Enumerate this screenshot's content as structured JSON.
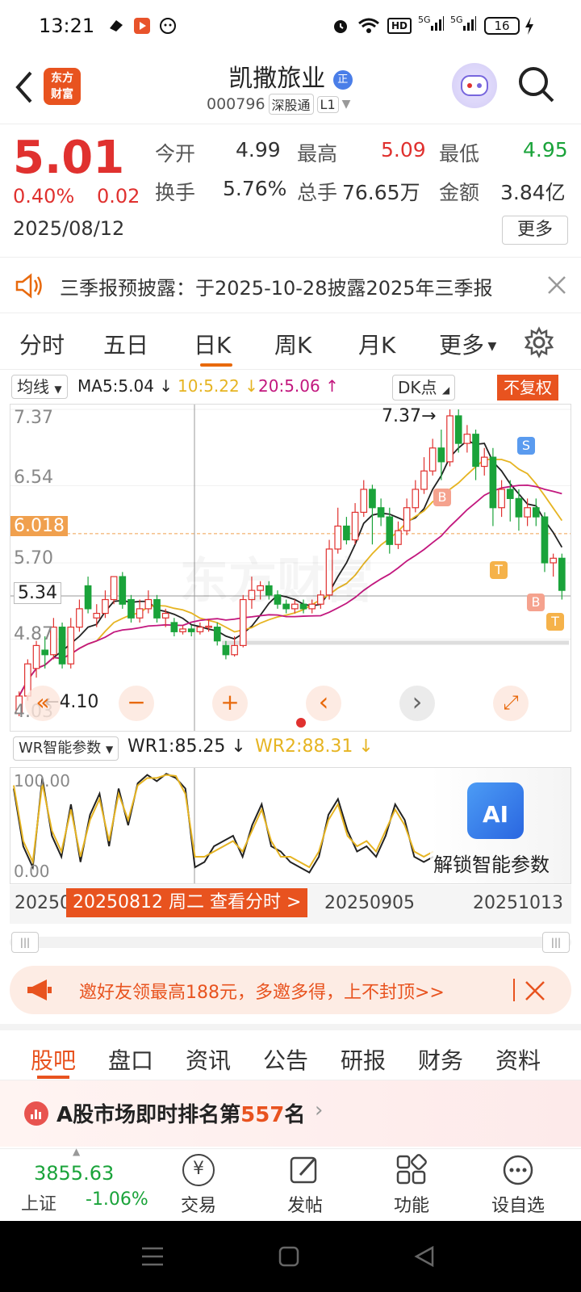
{
  "status": {
    "time": "13:21",
    "battery": "16",
    "hd": "HD",
    "net1": "5G",
    "net2": "5G"
  },
  "header": {
    "logo_line1": "东方",
    "logo_line2": "财富",
    "title": "凯撒旅业",
    "badge": "正",
    "code": "000796",
    "market": "深股通",
    "level": "L1"
  },
  "quote": {
    "price": "5.01",
    "change_pct": "0.40%",
    "change": "0.02",
    "date": "2025/08/12",
    "open_label": "今开",
    "open": "4.99",
    "high_label": "最高",
    "high": "5.09",
    "low_label": "最低",
    "low": "4.95",
    "turnover_label": "换手",
    "turnover": "5.76%",
    "volume_label": "总手",
    "volume": "76.65万",
    "amount_label": "金额",
    "amount": "3.84亿",
    "more": "更多"
  },
  "notice": {
    "text": "三季报预披露：于2025-10-28披露2025年三季报"
  },
  "tabs": [
    "分时",
    "五日",
    "日K",
    "周K",
    "月K",
    "更多"
  ],
  "active_tab": 2,
  "indicators": {
    "selector": "均线",
    "ma5": "MA5:5.04",
    "ma10": "10:5.22",
    "ma20": "20:5.06",
    "dk": "DK点",
    "adjust": "不复权"
  },
  "kchart": {
    "y_labels": [
      "7.37",
      "6.54",
      "5.70",
      "4.87",
      "4.03"
    ],
    "cursor_price": "5.34",
    "ref_price": "6.018",
    "peak_label": "7.37",
    "low_label": "4.10",
    "marks": {
      "b": "B",
      "s": "S",
      "t": "T"
    },
    "watermark": "东方财富"
  },
  "chart_data": {
    "type": "candlestick",
    "note_series": [
      "MA5",
      "MA10",
      "MA20"
    ],
    "ylim": [
      4.03,
      7.37
    ],
    "candles": [
      [
        4.06,
        4.25,
        4.03,
        4.3
      ],
      [
        4.25,
        4.6,
        4.2,
        4.65
      ],
      [
        4.55,
        4.8,
        4.45,
        4.85
      ],
      [
        4.75,
        4.7,
        4.55,
        4.9
      ],
      [
        4.7,
        5.0,
        4.65,
        5.1
      ],
      [
        5.0,
        4.6,
        4.55,
        5.05
      ],
      [
        4.6,
        5.0,
        4.55,
        5.1
      ],
      [
        5.0,
        5.2,
        4.95,
        5.3
      ],
      [
        5.45,
        5.2,
        5.15,
        5.55
      ],
      [
        5.1,
        5.15,
        5.0,
        5.25
      ],
      [
        5.15,
        5.3,
        5.1,
        5.4
      ],
      [
        5.3,
        5.55,
        5.25,
        5.55
      ],
      [
        5.55,
        5.25,
        5.2,
        5.6
      ],
      [
        5.3,
        5.1,
        5.05,
        5.35
      ],
      [
        5.1,
        5.2,
        5.05,
        5.3
      ],
      [
        5.2,
        5.3,
        5.15,
        5.4
      ],
      [
        5.3,
        5.1,
        5.05,
        5.35
      ],
      [
        5.1,
        5.15,
        5.0,
        5.2
      ],
      [
        5.05,
        4.95,
        4.9,
        5.1
      ],
      [
        4.95,
        4.98,
        4.92,
        5.02
      ],
      [
        4.98,
        4.95,
        4.9,
        5.02
      ],
      [
        4.95,
        5.0,
        4.92,
        5.05
      ],
      [
        5.0,
        5.01,
        4.95,
        5.09
      ],
      [
        5.0,
        4.85,
        4.8,
        5.05
      ],
      [
        4.8,
        4.7,
        4.65,
        4.85
      ],
      [
        4.7,
        4.8,
        4.68,
        4.9
      ],
      [
        4.8,
        5.3,
        4.78,
        5.35
      ],
      [
        5.3,
        5.4,
        5.2,
        5.55
      ],
      [
        5.4,
        5.45,
        5.3,
        5.5
      ],
      [
        5.45,
        5.35,
        5.3,
        5.5
      ],
      [
        5.35,
        5.25,
        5.2,
        5.4
      ],
      [
        5.25,
        5.2,
        5.15,
        5.3
      ],
      [
        5.2,
        5.25,
        5.15,
        5.3
      ],
      [
        5.25,
        5.2,
        5.15,
        5.3
      ],
      [
        5.2,
        5.25,
        5.15,
        5.3
      ],
      [
        5.25,
        5.35,
        5.2,
        5.4
      ],
      [
        5.35,
        5.85,
        5.3,
        5.95
      ],
      [
        5.85,
        6.1,
        5.8,
        6.3
      ],
      [
        6.1,
        5.95,
        5.9,
        6.2
      ],
      [
        5.95,
        6.25,
        5.9,
        6.35
      ],
      [
        6.25,
        6.5,
        6.2,
        6.6
      ],
      [
        6.5,
        6.3,
        5.9,
        6.55
      ],
      [
        6.3,
        6.2,
        6.1,
        6.4
      ],
      [
        6.2,
        5.9,
        5.8,
        6.3
      ],
      [
        5.9,
        6.05,
        5.85,
        6.15
      ],
      [
        6.05,
        6.3,
        6.0,
        6.4
      ],
      [
        6.3,
        6.5,
        6.25,
        6.6
      ],
      [
        6.5,
        6.7,
        6.45,
        6.85
      ],
      [
        6.7,
        6.95,
        6.65,
        7.05
      ],
      [
        6.95,
        6.8,
        6.6,
        7.15
      ],
      [
        6.8,
        7.3,
        6.75,
        7.37
      ],
      [
        7.3,
        7.0,
        6.9,
        7.37
      ],
      [
        7.0,
        7.1,
        6.9,
        7.2
      ],
      [
        7.1,
        6.75,
        6.6,
        7.15
      ],
      [
        6.75,
        6.85,
        6.65,
        6.95
      ],
      [
        6.85,
        6.3,
        6.1,
        6.95
      ],
      [
        6.3,
        6.5,
        6.2,
        6.6
      ],
      [
        6.5,
        6.4,
        6.15,
        6.6
      ],
      [
        6.4,
        6.2,
        6.05,
        6.5
      ],
      [
        6.2,
        6.3,
        6.1,
        6.4
      ],
      [
        6.3,
        6.2,
        6.1,
        6.4
      ],
      [
        6.2,
        5.7,
        5.6,
        6.25
      ],
      [
        5.7,
        5.75,
        5.55,
        5.8
      ],
      [
        5.75,
        5.4,
        5.3,
        5.8
      ]
    ]
  },
  "chart_nav": {
    "left": "«",
    "minus": "−",
    "plus": "+",
    "prev": "‹",
    "next": "›",
    "expand": "⤢"
  },
  "wr": {
    "selector": "WR智能参数",
    "wr1": "WR1:85.25",
    "wr2": "WR2:88.31",
    "top": "100.00",
    "bottom": "0.00",
    "ai_text": "解锁智能参数",
    "ai_icon": "AI",
    "values1": [
      85,
      30,
      10,
      95,
      40,
      20,
      70,
      15,
      60,
      80,
      30,
      85,
      50,
      90,
      98,
      92,
      99,
      95,
      85,
      10,
      15,
      30,
      35,
      40,
      20,
      50,
      70,
      30,
      25,
      15,
      10,
      5,
      20,
      60,
      75,
      45,
      25,
      30,
      20,
      40,
      70,
      55,
      20,
      15,
      20
    ],
    "values2": [
      88,
      35,
      15,
      90,
      45,
      25,
      65,
      20,
      55,
      75,
      35,
      80,
      55,
      88,
      95,
      95,
      98,
      97,
      80,
      20,
      20,
      25,
      30,
      35,
      25,
      45,
      65,
      35,
      20,
      20,
      15,
      10,
      25,
      55,
      70,
      40,
      30,
      35,
      25,
      45,
      65,
      50,
      25,
      20,
      25
    ]
  },
  "datebar": {
    "d1": "20250",
    "highlight": "20250812 周二 查看分时 >",
    "d2": "20250905",
    "d3": "20251013"
  },
  "promo": {
    "text": "邀好友领最高188元，多邀多得，上不封顶>>"
  },
  "bottom_tabs": [
    "股吧",
    "盘口",
    "资讯",
    "公告",
    "研报",
    "财务",
    "资料"
  ],
  "rank": {
    "prefix": "A股市场即时排名第",
    "number": "557",
    "suffix": "名"
  },
  "index": {
    "value": "3855.63",
    "name": "上证",
    "change": "-1.06%"
  },
  "nav": {
    "trade": "交易",
    "post": "发帖",
    "func": "功能",
    "watch": "设自选",
    "trade_icon": "¥"
  }
}
